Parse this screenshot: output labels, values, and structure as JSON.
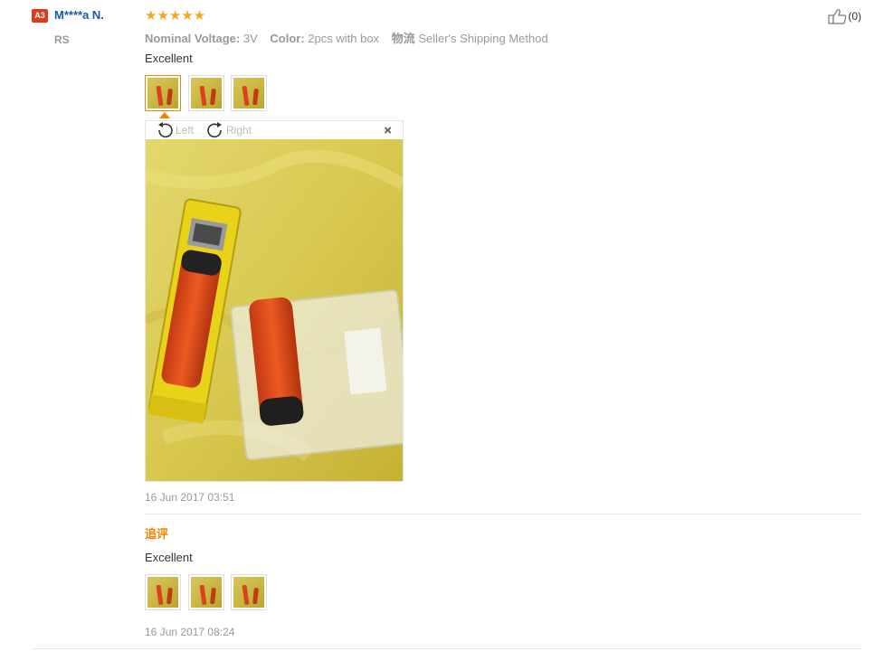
{
  "reviewer": {
    "badge": "A3",
    "name": "M****a N.",
    "country": "RS"
  },
  "rating": {
    "stars_text": "★★★★★",
    "value": 5,
    "max": 5
  },
  "attributes": [
    {
      "label": "Nominal Voltage:",
      "value": "3V"
    },
    {
      "label": "Color:",
      "value": "2pcs with box"
    },
    {
      "label": "物流",
      "value": "Seller's Shipping Method"
    }
  ],
  "review": {
    "text": "Excellent",
    "date": "16 Jun 2017 03:51",
    "thumbnail_count": 3
  },
  "viewer": {
    "rotate_left": "Left",
    "rotate_right": "Right",
    "close": "×"
  },
  "followup": {
    "heading": "追评",
    "text": "Excellent",
    "date": "16 Jun 2017 08:24",
    "thumbnail_count": 3
  },
  "helpful": {
    "count_text": "(0)",
    "count": 0
  },
  "colors": {
    "accent": "#f08400",
    "link": "#1b5aa8",
    "badge": "#e0391b"
  }
}
